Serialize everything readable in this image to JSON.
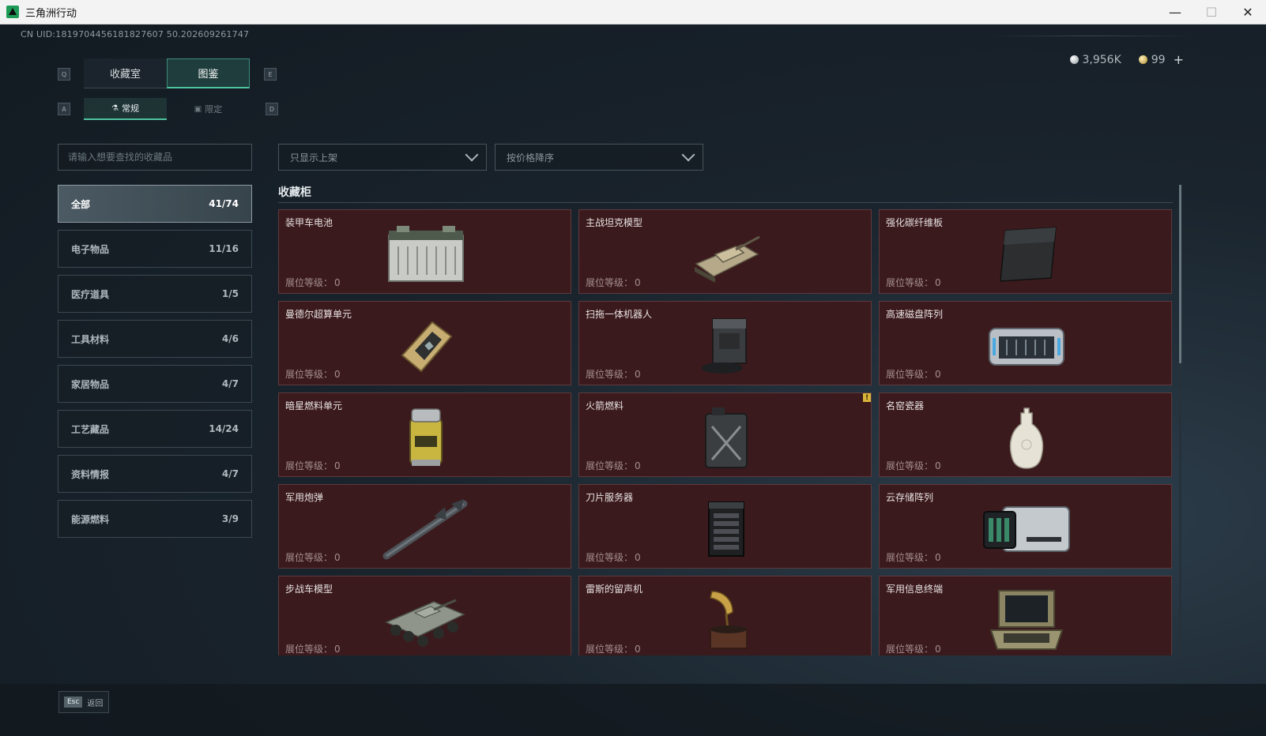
{
  "window": {
    "title": "三角洲行动",
    "minimize": "—",
    "maximize": "☐",
    "close": "✕"
  },
  "uid": "CN UID:1819704456181827607 50.202609261747",
  "currency": {
    "silver": "3,956K",
    "gold": "99",
    "plus": "+"
  },
  "keys": {
    "q": "Q",
    "e": "E",
    "a": "A",
    "d": "D"
  },
  "tabs": [
    {
      "label": "收藏室",
      "active": false
    },
    {
      "label": "图鉴",
      "active": true
    }
  ],
  "subtabs": [
    {
      "label": "常规",
      "icon": "flask-icon",
      "active": true
    },
    {
      "label": "限定",
      "icon": "image-icon",
      "active": false
    }
  ],
  "search": {
    "placeholder": "请输入想要查找的收藏品"
  },
  "filters": {
    "shelf": "只显示上架",
    "sort": "按价格降序"
  },
  "categories": [
    {
      "label": "全部",
      "count": "41/74"
    },
    {
      "label": "电子物品",
      "count": "11/16"
    },
    {
      "label": "医疗道具",
      "count": "1/5"
    },
    {
      "label": "工具材料",
      "count": "4/6"
    },
    {
      "label": "家居物品",
      "count": "4/7"
    },
    {
      "label": "工艺藏品",
      "count": "14/24"
    },
    {
      "label": "资料情报",
      "count": "4/7"
    },
    {
      "label": "能源燃料",
      "count": "3/9"
    }
  ],
  "section_title": "收藏柜",
  "level_label": "展位等级：",
  "items": [
    {
      "name": "装甲车电池",
      "level": "0",
      "icon": "battery-icon"
    },
    {
      "name": "主战坦克模型",
      "level": "0",
      "icon": "tank-icon"
    },
    {
      "name": "强化碳纤维板",
      "level": "0",
      "icon": "carbon-plate-icon"
    },
    {
      "name": "曼德尔超算单元",
      "level": "0",
      "icon": "chip-icon"
    },
    {
      "name": "扫拖一体机器人",
      "level": "0",
      "icon": "robot-vacuum-icon"
    },
    {
      "name": "高速磁盘阵列",
      "level": "0",
      "icon": "disk-array-icon"
    },
    {
      "name": "暗星燃料单元",
      "level": "0",
      "icon": "fuel-cell-icon"
    },
    {
      "name": "火箭燃料",
      "level": "0",
      "icon": "jerrycan-icon"
    },
    {
      "name": "名窑瓷器",
      "level": "0",
      "icon": "porcelain-vase-icon"
    },
    {
      "name": "军用炮弹",
      "level": "0",
      "icon": "missile-icon"
    },
    {
      "name": "刀片服务器",
      "level": "0",
      "icon": "server-icon"
    },
    {
      "name": "云存储阵列",
      "level": "0",
      "icon": "storage-array-icon"
    },
    {
      "name": "步战车模型",
      "level": "0",
      "icon": "ifv-icon"
    },
    {
      "name": "雷斯的留声机",
      "level": "0",
      "icon": "gramophone-icon"
    },
    {
      "name": "军用信息终端",
      "level": "0",
      "icon": "terminal-case-icon"
    }
  ],
  "warn_badge": "!",
  "esc": {
    "key": "Esc",
    "label": "返回"
  }
}
